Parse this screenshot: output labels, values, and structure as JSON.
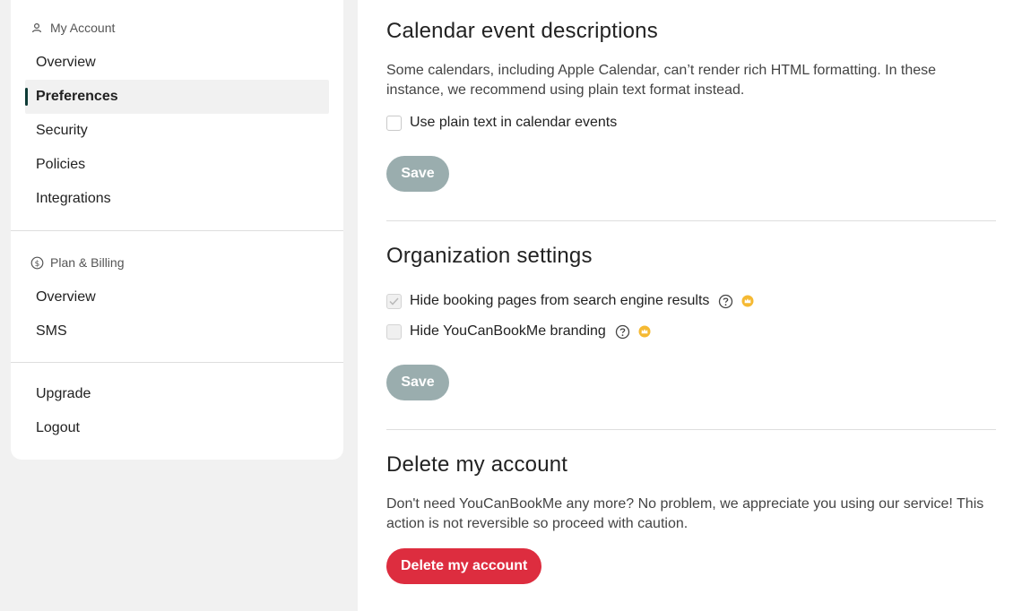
{
  "sidebar": {
    "account": {
      "heading": "My Account",
      "heading_icon": "user-icon",
      "items": [
        {
          "label": "Overview"
        },
        {
          "label": "Preferences",
          "active": true
        },
        {
          "label": "Security"
        },
        {
          "label": "Policies"
        },
        {
          "label": "Integrations"
        }
      ]
    },
    "billing": {
      "heading": "Plan & Billing",
      "heading_icon": "dollar-circle-icon",
      "items": [
        {
          "label": "Overview"
        },
        {
          "label": "SMS"
        }
      ]
    },
    "footer": {
      "items": [
        {
          "label": "Upgrade"
        },
        {
          "label": "Logout"
        }
      ]
    }
  },
  "calendar": {
    "title": "Calendar event descriptions",
    "description": "Some calendars, including Apple Calendar, can’t render rich HTML formatting. In these instance, we recommend using plain text format instead.",
    "checkbox_label": "Use plain text in calendar events",
    "checkbox_checked": false,
    "save_label": "Save"
  },
  "organization": {
    "title": "Organization settings",
    "options": [
      {
        "label": "Hide booking pages from search engine results",
        "checked": true,
        "disabled": true,
        "premium": true
      },
      {
        "label": "Hide YouCanBookMe branding",
        "checked": false,
        "disabled": true,
        "premium": true
      }
    ],
    "save_label": "Save"
  },
  "delete": {
    "title": "Delete my account",
    "description": "Don't need YouCanBookMe any more? No problem, we appreciate you using our service! This action is not reversible so proceed with caution.",
    "button_label": "Delete my account"
  },
  "colors": {
    "accent": "#0e3b36",
    "save_button": "#9aadae",
    "danger": "#dd2d3f",
    "premium": "#f5b932"
  }
}
